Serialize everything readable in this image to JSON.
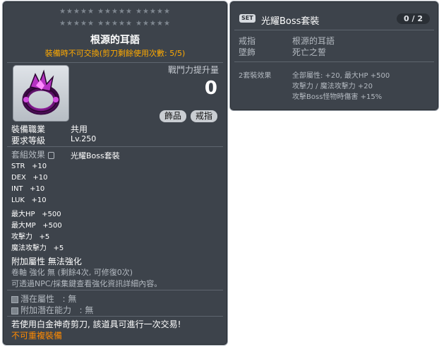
{
  "main": {
    "stars_row1": "★★★★★  ★★★★★  ★★★★★",
    "stars_row2": "★★★★★  ★★★★★  ★★★★★",
    "item_name": "根源的耳語",
    "trade_note": "裝備時不可交換(剪刀剩餘使用次數: 5/5)",
    "power_label": "戰鬥力提升量",
    "power_value": "0",
    "tags": [
      "飾品",
      "戒指"
    ],
    "job_label": "裝備職業",
    "job_value": "共用",
    "level_label": "要求等級",
    "level_value": "Lv.250",
    "set_effect_label": "套組效果",
    "set_effect_value": "光耀Boss套裝",
    "stats": [
      {
        "name": "STR",
        "value": "+10"
      },
      {
        "name": "DEX",
        "value": "+10"
      },
      {
        "name": "INT",
        "value": "+10"
      },
      {
        "name": "LUK",
        "value": "+10"
      },
      {
        "name": "最大HP",
        "value": "+500"
      },
      {
        "name": "最大MP",
        "value": "+500"
      },
      {
        "name": "攻擊力",
        "value": "+5"
      },
      {
        "name": "魔法攻擊力",
        "value": "+5"
      }
    ],
    "extra_attr": "附加屬性 無法強化",
    "scroll_line": "卷軸 強化 無 (剩餘4次, 可修復0次)",
    "npc_line": "可透過NPC/採集鍵查看強化資訊詳細內容。",
    "potential_label": "潛在屬性",
    "potential_value": ": 無",
    "add_potential_label": "附加潛在能力",
    "add_potential_value": ": 無",
    "scissor_note": "若使用白金神奇剪刀, 該道具可進行一次交易!",
    "no_duplicate": "不可重複裝備"
  },
  "set_panel": {
    "badge": "SET",
    "name": "光耀Boss套裝",
    "count": "0 / 2",
    "members": [
      {
        "type": "戒指",
        "item": "根源的耳語"
      },
      {
        "type": "墜飾",
        "item": "死亡之誓"
      }
    ],
    "tier_label": "2套裝效果",
    "effects": [
      "全部屬性: +20, 最大HP +500",
      "攻擊力 / 魔法攻擊力 +20",
      "攻擊Boss怪物時傷害 +15%"
    ]
  },
  "colors": {
    "panel_bg": "#3d434b",
    "trade_text": "#ffaa00",
    "warning_text": "#ff8a00"
  }
}
